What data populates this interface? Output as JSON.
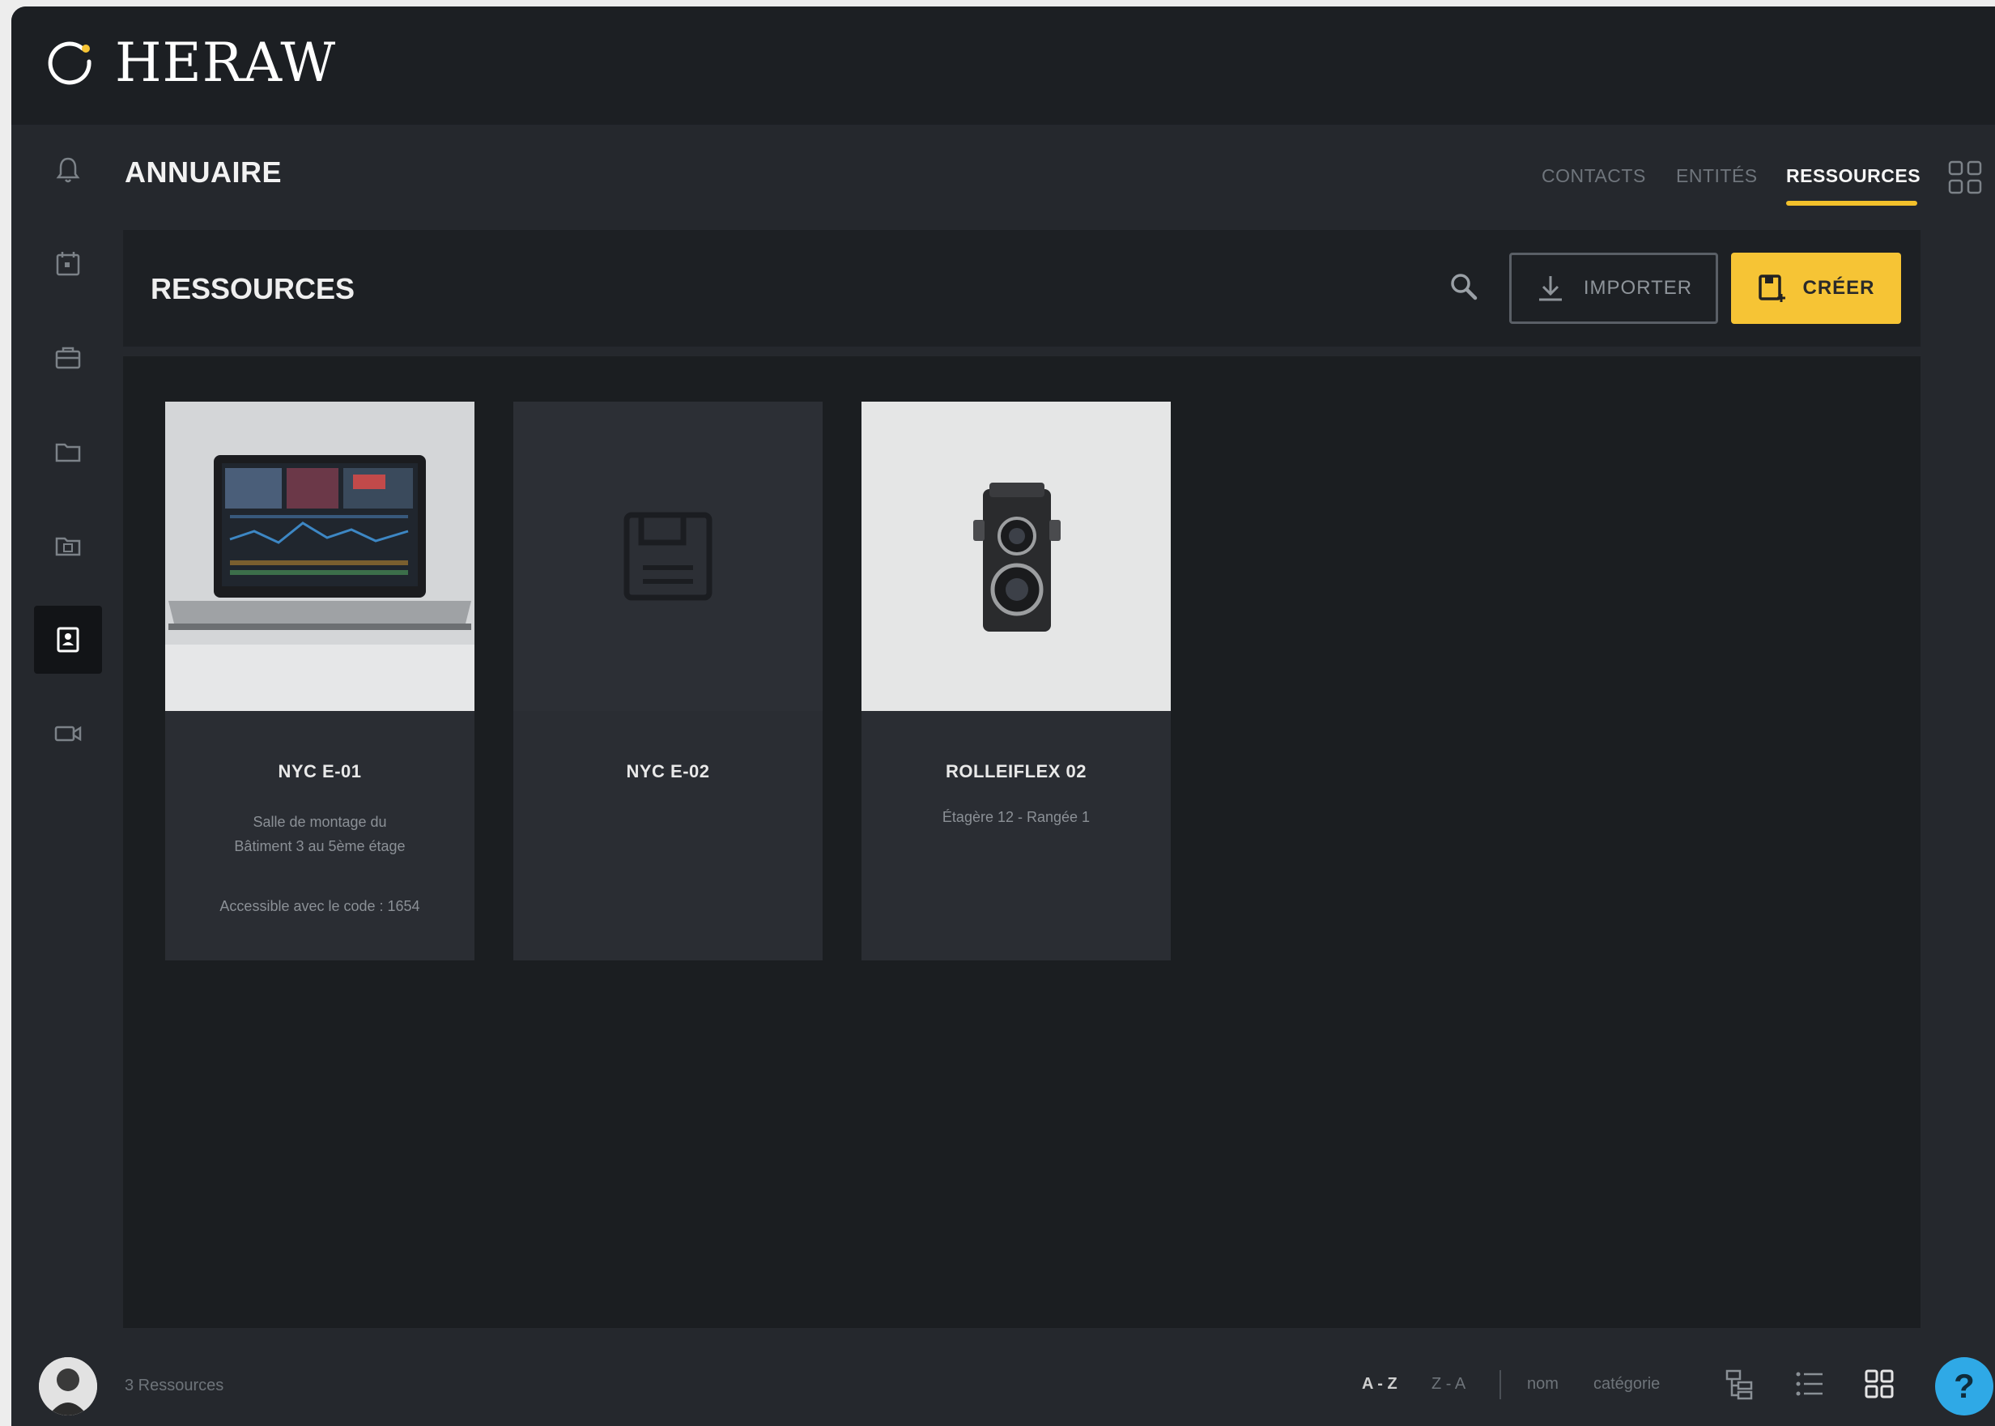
{
  "brand": {
    "name": "HERAW",
    "accent": "#f6c435"
  },
  "sidebar": {
    "items": [
      {
        "name": "calendar-icon",
        "active": false
      },
      {
        "name": "briefcase-icon",
        "active": false
      },
      {
        "name": "folder-icon",
        "active": false
      },
      {
        "name": "folder-calendar-icon",
        "active": false
      },
      {
        "name": "contact-card-icon",
        "active": true
      },
      {
        "name": "video-camera-icon",
        "active": false
      }
    ]
  },
  "header": {
    "title": "ANNUAIRE",
    "bell_icon": "bell-icon",
    "tabs": [
      {
        "label": "CONTACTS",
        "active": false
      },
      {
        "label": "ENTITÉS",
        "active": false
      },
      {
        "label": "RESSOURCES",
        "active": true
      }
    ],
    "apps_icon": "apps-grid-icon"
  },
  "toolbar": {
    "title": "RESSOURCES",
    "import_label": "IMPORTER",
    "create_label": "CRÉER"
  },
  "cards": [
    {
      "title": "NYC E-01",
      "desc_line1": "Salle de montage du",
      "desc_line2": "Bâtiment 3 au 5ème étage",
      "desc_line3": "Accessible avec le code : 1654",
      "image": "laptop-photo"
    },
    {
      "title": "NYC E-02",
      "desc_line1": "",
      "desc_line2": "",
      "desc_line3": "",
      "image": "placeholder-icon"
    },
    {
      "title": "ROLLEIFLEX 02",
      "desc_line1": "Étagère 12 - Rangée 1",
      "desc_line2": "",
      "desc_line3": "",
      "image": "camera-photo"
    }
  ],
  "footer": {
    "count": "3 Ressources",
    "sort_az": "A - Z",
    "sort_za": "Z - A",
    "sort_name": "nom",
    "sort_category": "catégorie",
    "help": "?"
  }
}
